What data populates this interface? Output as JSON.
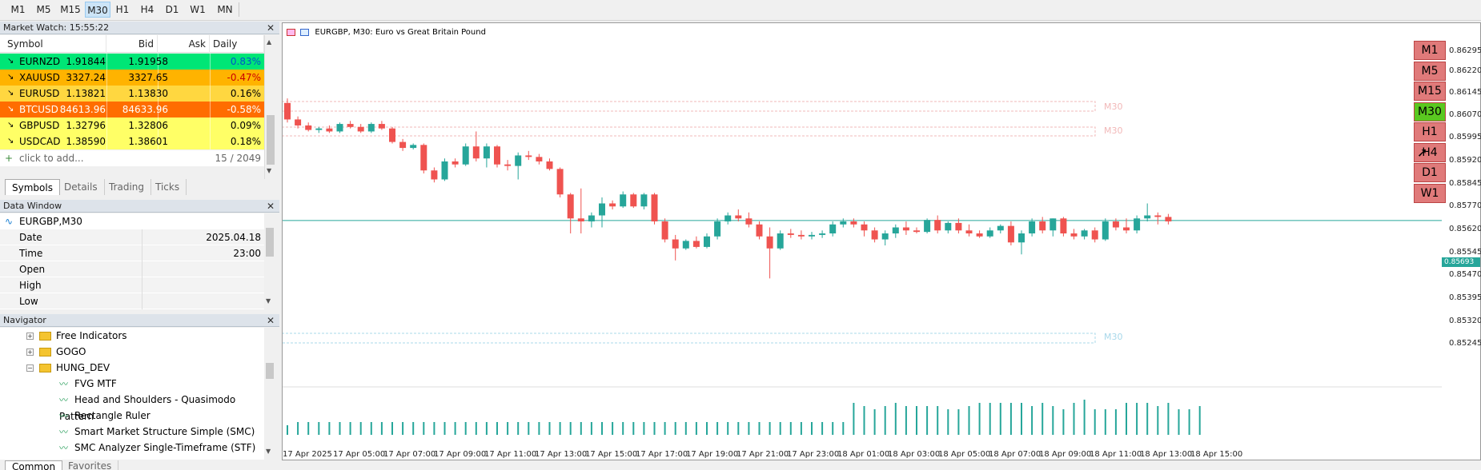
{
  "toolbar": {
    "timeframes": [
      "M1",
      "M5",
      "M15",
      "M30",
      "H1",
      "H4",
      "D1",
      "W1",
      "MN"
    ],
    "active": "M30"
  },
  "market_watch": {
    "title": "Market Watch: 15:55:22",
    "headers": [
      "Symbol",
      "Bid",
      "Ask",
      "Daily Ch..."
    ],
    "rows": [
      {
        "symbol": "EURNZD",
        "bid": "1.91844",
        "ask": "1.91958",
        "change": "0.83%",
        "bg": "#00e676",
        "fg": "#000",
        "arrow": "↘"
      },
      {
        "symbol": "XAUUSD",
        "bid": "3327.24",
        "ask": "3327.65",
        "change": "-0.47%",
        "bg": "#ffb300",
        "fg": "#000",
        "arrow": "↘"
      },
      {
        "symbol": "EURUSD",
        "bid": "1.13821",
        "ask": "1.13830",
        "change": "0.16%",
        "bg": "#ffd740",
        "fg": "#000",
        "arrow": "↘"
      },
      {
        "symbol": "BTCUSD",
        "bid": "84613.96",
        "ask": "84633.96",
        "change": "-0.58%",
        "bg": "#ff6d00",
        "fg": "#fff",
        "arrow": "↘"
      },
      {
        "symbol": "GBPUSD",
        "bid": "1.32796",
        "ask": "1.32806",
        "change": "0.09%",
        "bg": "#ffff66",
        "fg": "#000",
        "arrow": "↘"
      },
      {
        "symbol": "USDCAD",
        "bid": "1.38590",
        "ask": "1.38601",
        "change": "0.18%",
        "bg": "#ffff66",
        "fg": "#000",
        "arrow": "↘"
      }
    ],
    "add_label": "click to add...",
    "count": "15 / 2049",
    "tabs": [
      "Symbols",
      "Details",
      "Trading",
      "Ticks"
    ]
  },
  "data_window": {
    "title": "Data Window",
    "symbol": "EURGBP,M30",
    "rows": [
      {
        "label": "Date",
        "value": "2025.04.18"
      },
      {
        "label": "Time",
        "value": "23:00"
      },
      {
        "label": "Open",
        "value": ""
      },
      {
        "label": "High",
        "value": ""
      },
      {
        "label": "Low",
        "value": ""
      }
    ]
  },
  "navigator": {
    "title": "Navigator",
    "items": [
      {
        "label": "Free Indicators",
        "type": "folder"
      },
      {
        "label": "GOGO",
        "type": "folder"
      },
      {
        "label": "HUNG_DEV",
        "type": "folder"
      },
      {
        "label": "FVG MTF",
        "type": "indicator"
      },
      {
        "label": "Head and Shoulders - Quasimodo Pattern",
        "type": "indicator"
      },
      {
        "label": "Rectangle Ruler",
        "type": "indicator"
      },
      {
        "label": "Smart Market Structure Simple (SMC)",
        "type": "indicator"
      },
      {
        "label": "SMC Analyzer Single-Timeframe (STF)",
        "type": "indicator"
      }
    ],
    "tabs": [
      "Common",
      "Favorites"
    ]
  },
  "chart": {
    "title": "EURGBP, M30:  Euro vs Great Britain Pound",
    "current_price": "0.85693",
    "price_labels": [
      "0.86295",
      "0.86220",
      "0.86145",
      "0.86070",
      "0.85995",
      "0.85920",
      "0.85845",
      "0.85770",
      "0.85620",
      "0.85545",
      "0.85470",
      "0.85395",
      "0.85320",
      "0.85245"
    ],
    "time_labels": [
      "17 Apr 2025",
      "17 Apr 05:00",
      "17 Apr 07:00",
      "17 Apr 09:00",
      "17 Apr 11:00",
      "17 Apr 13:00",
      "17 Apr 15:00",
      "17 Apr 17:00",
      "17 Apr 19:00",
      "17 Apr 21:00",
      "17 Apr 23:00",
      "18 Apr 01:00",
      "18 Apr 03:00",
      "18 Apr 05:00",
      "18 Apr 07:00",
      "18 Apr 09:00",
      "18 Apr 11:00",
      "18 Apr 13:00",
      "18 Apr 15:00"
    ],
    "fvg_labels": [
      "M30",
      "M30",
      "M30"
    ],
    "tf_panel": [
      "M1",
      "M5",
      "M15",
      "M30",
      "H1",
      "H4",
      "D1",
      "W1"
    ],
    "tf_active": "M30",
    "colors": {
      "bull": "#26a69a",
      "bear": "#ef5350",
      "fvg_red": "#f2b8b8",
      "fvg_blue": "#a8d8ea"
    },
    "candles": [
      [
        0.86085,
        0.861,
        0.8602,
        0.8603
      ],
      [
        0.8603,
        0.8604,
        0.86,
        0.8601
      ],
      [
        0.8601,
        0.8602,
        0.8599,
        0.85995
      ],
      [
        0.85995,
        0.86005,
        0.85985,
        0.86
      ],
      [
        0.86,
        0.8601,
        0.85985,
        0.8599
      ],
      [
        0.8599,
        0.8602,
        0.85985,
        0.86015
      ],
      [
        0.86015,
        0.86025,
        0.86,
        0.86005
      ],
      [
        0.86005,
        0.86015,
        0.85985,
        0.8599
      ],
      [
        0.8599,
        0.8602,
        0.85985,
        0.86015
      ],
      [
        0.86015,
        0.86025,
        0.85995,
        0.86
      ],
      [
        0.86,
        0.86005,
        0.8595,
        0.85955
      ],
      [
        0.85955,
        0.85965,
        0.85925,
        0.85935
      ],
      [
        0.85935,
        0.8595,
        0.8593,
        0.85945
      ],
      [
        0.85945,
        0.8595,
        0.8585,
        0.8586
      ],
      [
        0.8586,
        0.8587,
        0.8582,
        0.8583
      ],
      [
        0.8583,
        0.859,
        0.85825,
        0.8589
      ],
      [
        0.8589,
        0.859,
        0.8587,
        0.8588
      ],
      [
        0.8588,
        0.8595,
        0.85875,
        0.8594
      ],
      [
        0.8594,
        0.8599,
        0.8589,
        0.859
      ],
      [
        0.859,
        0.8595,
        0.8587,
        0.8594
      ],
      [
        0.8594,
        0.85945,
        0.8587,
        0.8588
      ],
      [
        0.8588,
        0.85895,
        0.8586,
        0.85875
      ],
      [
        0.85875,
        0.8592,
        0.8583,
        0.8591
      ],
      [
        0.8591,
        0.85925,
        0.85895,
        0.85905
      ],
      [
        0.85905,
        0.85915,
        0.8588,
        0.8589
      ],
      [
        0.8589,
        0.859,
        0.8586,
        0.85865
      ],
      [
        0.85865,
        0.8587,
        0.8577,
        0.8578
      ],
      [
        0.8578,
        0.85785,
        0.8565,
        0.857
      ],
      [
        0.857,
        0.858,
        0.8565,
        0.8569
      ],
      [
        0.8569,
        0.8572,
        0.8567,
        0.8571
      ],
      [
        0.8571,
        0.8577,
        0.8567,
        0.8575
      ],
      [
        0.8575,
        0.8576,
        0.8573,
        0.8574
      ],
      [
        0.8574,
        0.8579,
        0.85735,
        0.8578
      ],
      [
        0.8578,
        0.85785,
        0.85735,
        0.8574
      ],
      [
        0.8574,
        0.85785,
        0.8573,
        0.8578
      ],
      [
        0.8578,
        0.85785,
        0.8568,
        0.8569
      ],
      [
        0.8569,
        0.857,
        0.8562,
        0.8563
      ],
      [
        0.8563,
        0.85645,
        0.8556,
        0.856
      ],
      [
        0.856,
        0.8563,
        0.85595,
        0.85625
      ],
      [
        0.85625,
        0.8564,
        0.856,
        0.85605
      ],
      [
        0.85605,
        0.8565,
        0.856,
        0.8564
      ],
      [
        0.8564,
        0.857,
        0.8563,
        0.8569
      ],
      [
        0.8569,
        0.8572,
        0.8568,
        0.8571
      ],
      [
        0.8571,
        0.8573,
        0.8569,
        0.857
      ],
      [
        0.857,
        0.8572,
        0.8567,
        0.8568
      ],
      [
        0.8568,
        0.8569,
        0.8563,
        0.8564
      ],
      [
        0.8564,
        0.8567,
        0.855,
        0.856
      ],
      [
        0.856,
        0.8566,
        0.85595,
        0.8565
      ],
      [
        0.8565,
        0.85665,
        0.85635,
        0.85645
      ],
      [
        0.85645,
        0.8566,
        0.8563,
        0.8564
      ],
      [
        0.8564,
        0.85655,
        0.8563,
        0.85645
      ],
      [
        0.85645,
        0.8566,
        0.85635,
        0.8565
      ],
      [
        0.8565,
        0.8569,
        0.8564,
        0.8568
      ],
      [
        0.8568,
        0.857,
        0.8567,
        0.8569
      ],
      [
        0.8569,
        0.857,
        0.8567,
        0.8568
      ],
      [
        0.8568,
        0.8569,
        0.8564,
        0.8566
      ],
      [
        0.8566,
        0.8567,
        0.8562,
        0.8563
      ],
      [
        0.8563,
        0.8566,
        0.8561,
        0.8565
      ],
      [
        0.8565,
        0.8568,
        0.85635,
        0.8567
      ],
      [
        0.8567,
        0.8569,
        0.85645,
        0.8566
      ],
      [
        0.8566,
        0.8567,
        0.8565,
        0.85655
      ],
      [
        0.85655,
        0.857,
        0.8565,
        0.85695
      ],
      [
        0.85695,
        0.8571,
        0.8565,
        0.8566
      ],
      [
        0.8566,
        0.8569,
        0.8565,
        0.85685
      ],
      [
        0.85685,
        0.857,
        0.8565,
        0.8566
      ],
      [
        0.8566,
        0.8568,
        0.8564,
        0.8565
      ],
      [
        0.8565,
        0.8566,
        0.85635,
        0.8564
      ],
      [
        0.8564,
        0.8567,
        0.85635,
        0.8566
      ],
      [
        0.8566,
        0.8568,
        0.8565,
        0.85675
      ],
      [
        0.85675,
        0.8569,
        0.8561,
        0.8562
      ],
      [
        0.8562,
        0.8566,
        0.8558,
        0.8565
      ],
      [
        0.8565,
        0.857,
        0.8564,
        0.8569
      ],
      [
        0.8569,
        0.85705,
        0.8565,
        0.8566
      ],
      [
        0.8566,
        0.857,
        0.8564,
        0.857
      ],
      [
        0.857,
        0.85705,
        0.8564,
        0.8565
      ],
      [
        0.8565,
        0.85665,
        0.8563,
        0.8564
      ],
      [
        0.8564,
        0.85665,
        0.8563,
        0.8566
      ],
      [
        0.8566,
        0.8567,
        0.8562,
        0.8563
      ],
      [
        0.8563,
        0.857,
        0.85625,
        0.8569
      ],
      [
        0.8569,
        0.857,
        0.8566,
        0.8567
      ],
      [
        0.8567,
        0.857,
        0.8565,
        0.8566
      ],
      [
        0.8566,
        0.8571,
        0.8565,
        0.857
      ],
      [
        0.857,
        0.8575,
        0.8569,
        0.8571
      ],
      [
        0.8571,
        0.8572,
        0.8568,
        0.85705
      ],
      [
        0.85705,
        0.85715,
        0.8568,
        0.8569
      ]
    ],
    "volume_heights": [
      6,
      8,
      8,
      8,
      8,
      8,
      8,
      8,
      8,
      8,
      8,
      8,
      8,
      8,
      8,
      8,
      8,
      8,
      8,
      8,
      8,
      8,
      8,
      8,
      8,
      8,
      8,
      8,
      8,
      8,
      8,
      8,
      8,
      8,
      8,
      8,
      8,
      8,
      8,
      8,
      8,
      8,
      8,
      8,
      8,
      8,
      8,
      8,
      8,
      8,
      8,
      8,
      8,
      8,
      20,
      18,
      16,
      18,
      20,
      18,
      18,
      18,
      18,
      16,
      16,
      18,
      20,
      20,
      20,
      20,
      20,
      18,
      20,
      18,
      16,
      20,
      22,
      16,
      16,
      16,
      20,
      20,
      20,
      18,
      20,
      16,
      16,
      18
    ]
  }
}
